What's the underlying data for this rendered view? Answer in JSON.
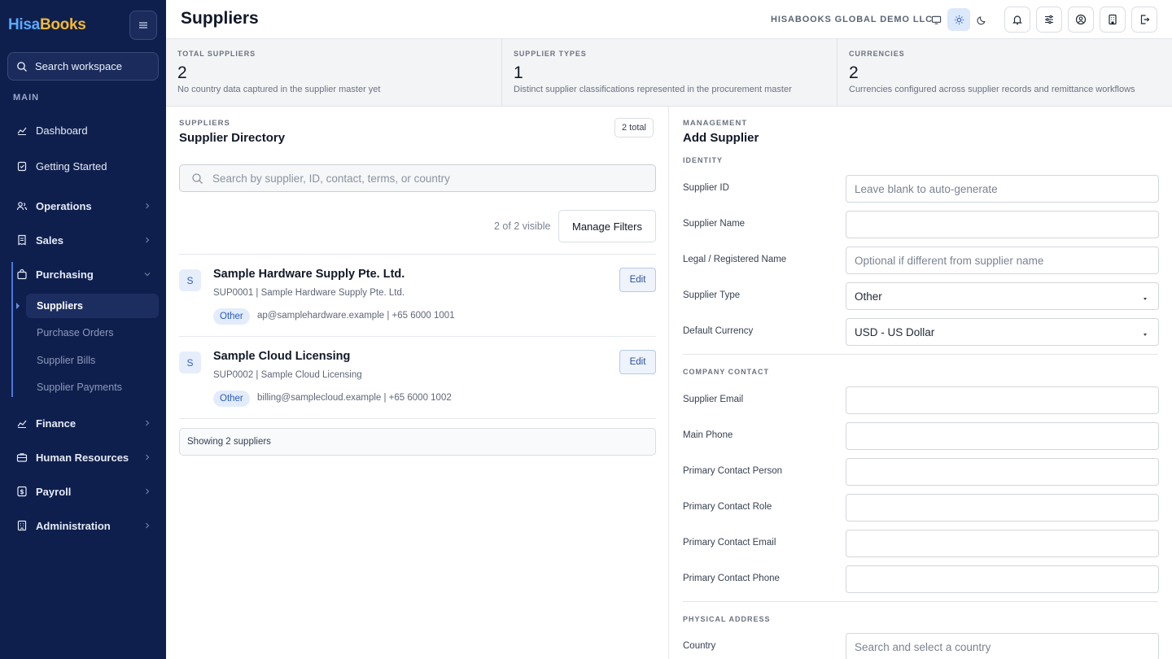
{
  "brand": {
    "part1": "Hisa",
    "part2": "Books"
  },
  "sidebar": {
    "search_placeholder": "Search workspace",
    "section_label": "MAIN",
    "items": [
      {
        "label": "Dashboard",
        "icon": "chart-icon"
      },
      {
        "label": "Getting Started",
        "icon": "clipboard-check-icon"
      },
      {
        "label": "Operations",
        "icon": "users-icon"
      },
      {
        "label": "Sales",
        "icon": "receipt-icon"
      },
      {
        "label": "Purchasing",
        "icon": "shopping-bag-icon"
      },
      {
        "label": "Finance",
        "icon": "trend-icon"
      },
      {
        "label": "Human Resources",
        "icon": "briefcase-icon"
      },
      {
        "label": "Payroll",
        "icon": "money-icon"
      },
      {
        "label": "Administration",
        "icon": "building-icon"
      }
    ],
    "purchasing_sub": [
      "Suppliers",
      "Purchase Orders",
      "Supplier Bills",
      "Supplier Payments"
    ]
  },
  "header": {
    "title": "Suppliers",
    "company": "HISABOOKS GLOBAL DEMO LLC",
    "theme_active": "light"
  },
  "stats": [
    {
      "label": "TOTAL SUPPLIERS",
      "value": "2",
      "desc": "No country data captured in the supplier master yet"
    },
    {
      "label": "SUPPLIER TYPES",
      "value": "1",
      "desc": "Distinct supplier classifications represented in the procurement master"
    },
    {
      "label": "CURRENCIES",
      "value": "2",
      "desc": "Currencies configured across supplier records and remittance workflows"
    }
  ],
  "directory": {
    "section": "SUPPLIERS",
    "title": "Supplier Directory",
    "total_badge": "2 total",
    "search_placeholder": "Search by supplier, ID, contact, terms, or country",
    "visible": "2 of 2 visible",
    "manage_filters": "Manage Filters",
    "rows": [
      {
        "initial": "S",
        "name": "Sample Hardware Supply Pte. Ltd.",
        "sub": "SUP0001 | Sample Hardware Supply Pte. Ltd.",
        "tag": "Other",
        "contact": "ap@samplehardware.example | +65 6000 1001",
        "edit": "Edit"
      },
      {
        "initial": "S",
        "name": "Sample Cloud Licensing",
        "sub": "SUP0002 | Sample Cloud Licensing",
        "tag": "Other",
        "contact": "billing@samplecloud.example | +65 6000 1002",
        "edit": "Edit"
      }
    ],
    "showing": "Showing 2 suppliers"
  },
  "form": {
    "section": "MANAGEMENT",
    "title": "Add Supplier",
    "identity_label": "IDENTITY",
    "contact_label": "COMPANY CONTACT",
    "address_label": "PHYSICAL ADDRESS",
    "supplier_id": {
      "label": "Supplier ID",
      "placeholder": "Leave blank to auto-generate"
    },
    "supplier_name": {
      "label": "Supplier Name",
      "value": ""
    },
    "legal_name": {
      "label": "Legal / Registered Name",
      "placeholder": "Optional if different from supplier name"
    },
    "supplier_type": {
      "label": "Supplier Type",
      "value": "Other"
    },
    "default_currency": {
      "label": "Default Currency",
      "value": "USD - US Dollar"
    },
    "supplier_email": {
      "label": "Supplier Email",
      "value": ""
    },
    "main_phone": {
      "label": "Main Phone",
      "value": ""
    },
    "contact_person": {
      "label": "Primary Contact Person",
      "value": ""
    },
    "contact_role": {
      "label": "Primary Contact Role",
      "value": ""
    },
    "contact_email": {
      "label": "Primary Contact Email",
      "value": ""
    },
    "contact_phone": {
      "label": "Primary Contact Phone",
      "value": ""
    },
    "country": {
      "label": "Country",
      "placeholder": "Search and select a country"
    }
  }
}
